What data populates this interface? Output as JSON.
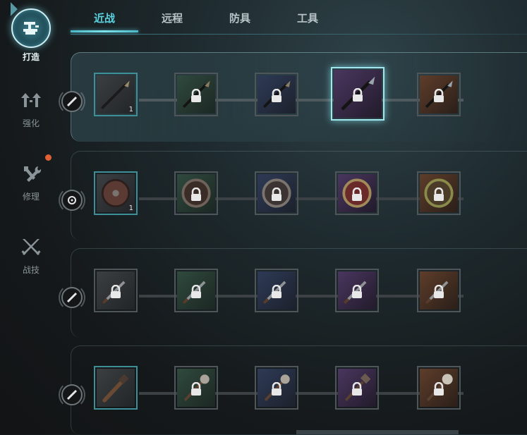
{
  "sidebar": {
    "items": [
      {
        "label": "打造",
        "icon": "anvil-icon",
        "active": true
      },
      {
        "label": "强化",
        "icon": "upgrade-arrows-icon",
        "active": false
      },
      {
        "label": "修理",
        "icon": "hammer-wrench-icon",
        "active": false,
        "alert": true
      },
      {
        "label": "战技",
        "icon": "crossed-swords-icon",
        "active": false
      }
    ]
  },
  "tabs": [
    {
      "label": "近战",
      "active": true
    },
    {
      "label": "远程",
      "active": false
    },
    {
      "label": "防具",
      "active": false
    },
    {
      "label": "工具",
      "active": false
    }
  ],
  "rows": [
    {
      "type_icon": "sword-slash-icon",
      "active": true,
      "slots": [
        {
          "tier": "grey",
          "item": "spear-icon",
          "owned": true,
          "count": "1",
          "locked": false
        },
        {
          "tier": "green",
          "item": "spear-icon",
          "locked": true
        },
        {
          "tier": "blue",
          "item": "spear-icon",
          "locked": true
        },
        {
          "tier": "purple",
          "item": "spear-icon",
          "locked": true,
          "selected": true
        },
        {
          "tier": "orange",
          "item": "spear-icon",
          "locked": true
        }
      ]
    },
    {
      "type_icon": "shield-target-icon",
      "active": false,
      "slots": [
        {
          "tier": "grey",
          "item": "round-shield-icon",
          "owned": true,
          "count": "1",
          "locked": false
        },
        {
          "tier": "green",
          "item": "round-shield-icon",
          "locked": true
        },
        {
          "tier": "blue",
          "item": "round-shield-icon",
          "locked": true
        },
        {
          "tier": "purple",
          "item": "round-shield-icon",
          "locked": true
        },
        {
          "tier": "orange",
          "item": "round-shield-icon",
          "locked": true
        }
      ]
    },
    {
      "type_icon": "sword-slash-icon",
      "active": false,
      "slots": [
        {
          "tier": "grey",
          "item": "sword-icon",
          "locked": true
        },
        {
          "tier": "green",
          "item": "sword-icon",
          "locked": true
        },
        {
          "tier": "blue",
          "item": "sword-icon",
          "locked": true
        },
        {
          "tier": "purple",
          "item": "sword-icon",
          "locked": true
        },
        {
          "tier": "orange",
          "item": "sword-icon",
          "locked": true
        }
      ]
    },
    {
      "type_icon": "sword-slash-icon",
      "active": false,
      "slots": [
        {
          "tier": "grey",
          "item": "club-icon",
          "owned": true,
          "locked": false
        },
        {
          "tier": "green",
          "item": "mace-icon",
          "locked": true
        },
        {
          "tier": "blue",
          "item": "mace-icon",
          "locked": true
        },
        {
          "tier": "purple",
          "item": "mace-icon",
          "locked": true
        },
        {
          "tier": "orange",
          "item": "mace-icon",
          "locked": true
        }
      ]
    }
  ],
  "colors": {
    "accent": "#59d3e0",
    "grey": "#3b3f42",
    "green": "#2f4a3e",
    "blue": "#2e3a56",
    "purple": "#4a365f",
    "orange": "#5e3d2a",
    "alert": "#e06234"
  }
}
